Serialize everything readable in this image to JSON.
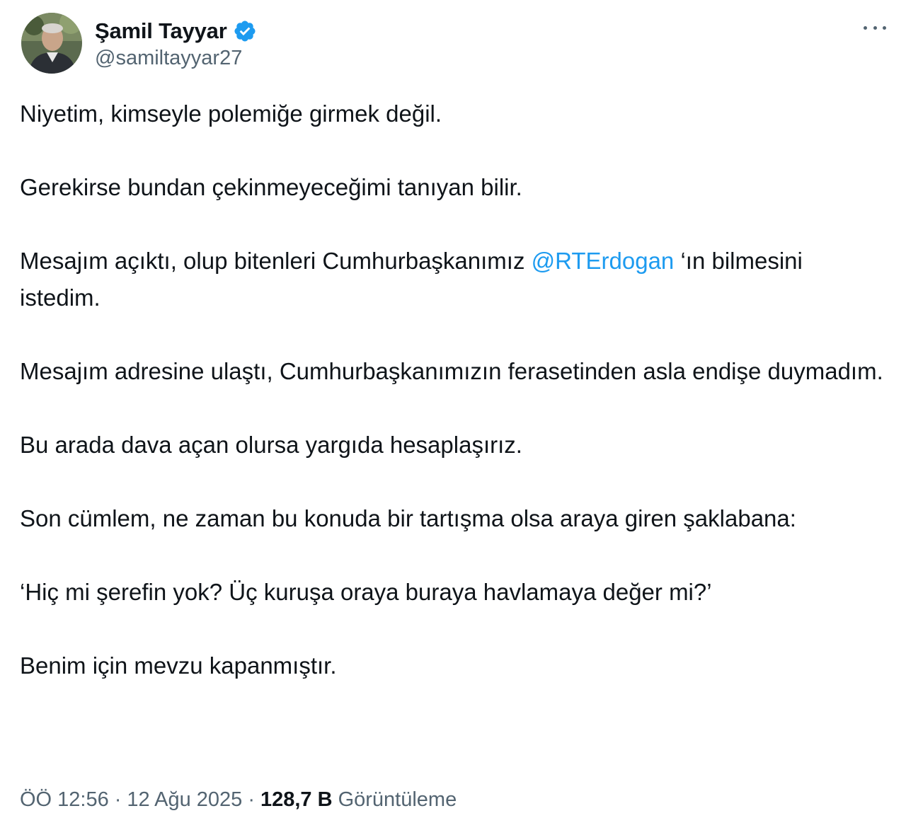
{
  "author": {
    "display_name": "Şamil Tayyar",
    "handle": "@samiltayyar27",
    "verified": true,
    "badge_color": "#1d9bf0"
  },
  "tweet": {
    "paragraphs": [
      {
        "text": "Niyetim, kimseyle polemiğe girmek değil."
      },
      {
        "text": "Gerekirse bundan çekinmeyeceğimi tanıyan bilir."
      },
      {
        "before": "Mesajım açıktı, olup bitenleri Cumhurbaşkanımız ",
        "mention": "@RTErdogan",
        "after": " ‘ın bilmesini istedim."
      },
      {
        "text": "Mesajım adresine ulaştı, Cumhurbaşkanımızın ferasetinden asla endişe duymadım."
      },
      {
        "text": "Bu arada dava açan olursa yargıda hesaplaşırız."
      },
      {
        "text": "Son cümlem, ne zaman bu konuda bir tartışma olsa araya giren şaklabana:"
      },
      {
        "text": "‘Hiç mi şerefin yok? Üç kuruşa oraya buraya havlamaya değer mi?’"
      },
      {
        "text": "Benim için mevzu kapanmıştır."
      }
    ]
  },
  "meta": {
    "time": "ÖÖ 12:56",
    "separator": "·",
    "date": "12 Ağu 2025",
    "views_count": "128,7 B",
    "views_label": "Görüntüleme"
  },
  "icons": {
    "more": "more-horizontal-icon",
    "verified": "verified-badge-icon"
  },
  "colors": {
    "text": "#0f1419",
    "secondary": "#536471",
    "link": "#1d9bf0"
  }
}
